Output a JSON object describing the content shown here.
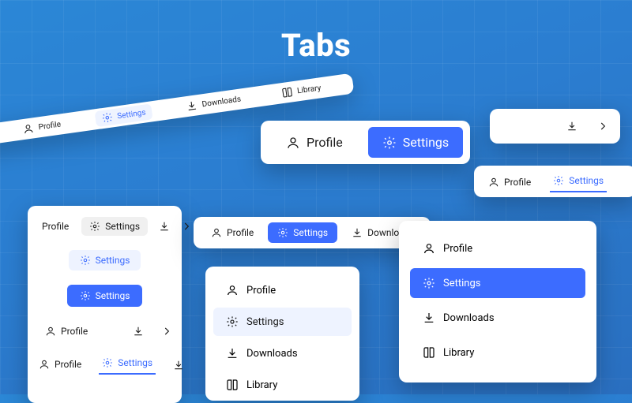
{
  "title": "Tabs",
  "tabs": {
    "profile": "Profile",
    "settings": "Settings",
    "downloads": "Downloads",
    "library": "Library"
  },
  "colors": {
    "accent": "#3c6cff",
    "accentLight": "#eef3ff"
  }
}
